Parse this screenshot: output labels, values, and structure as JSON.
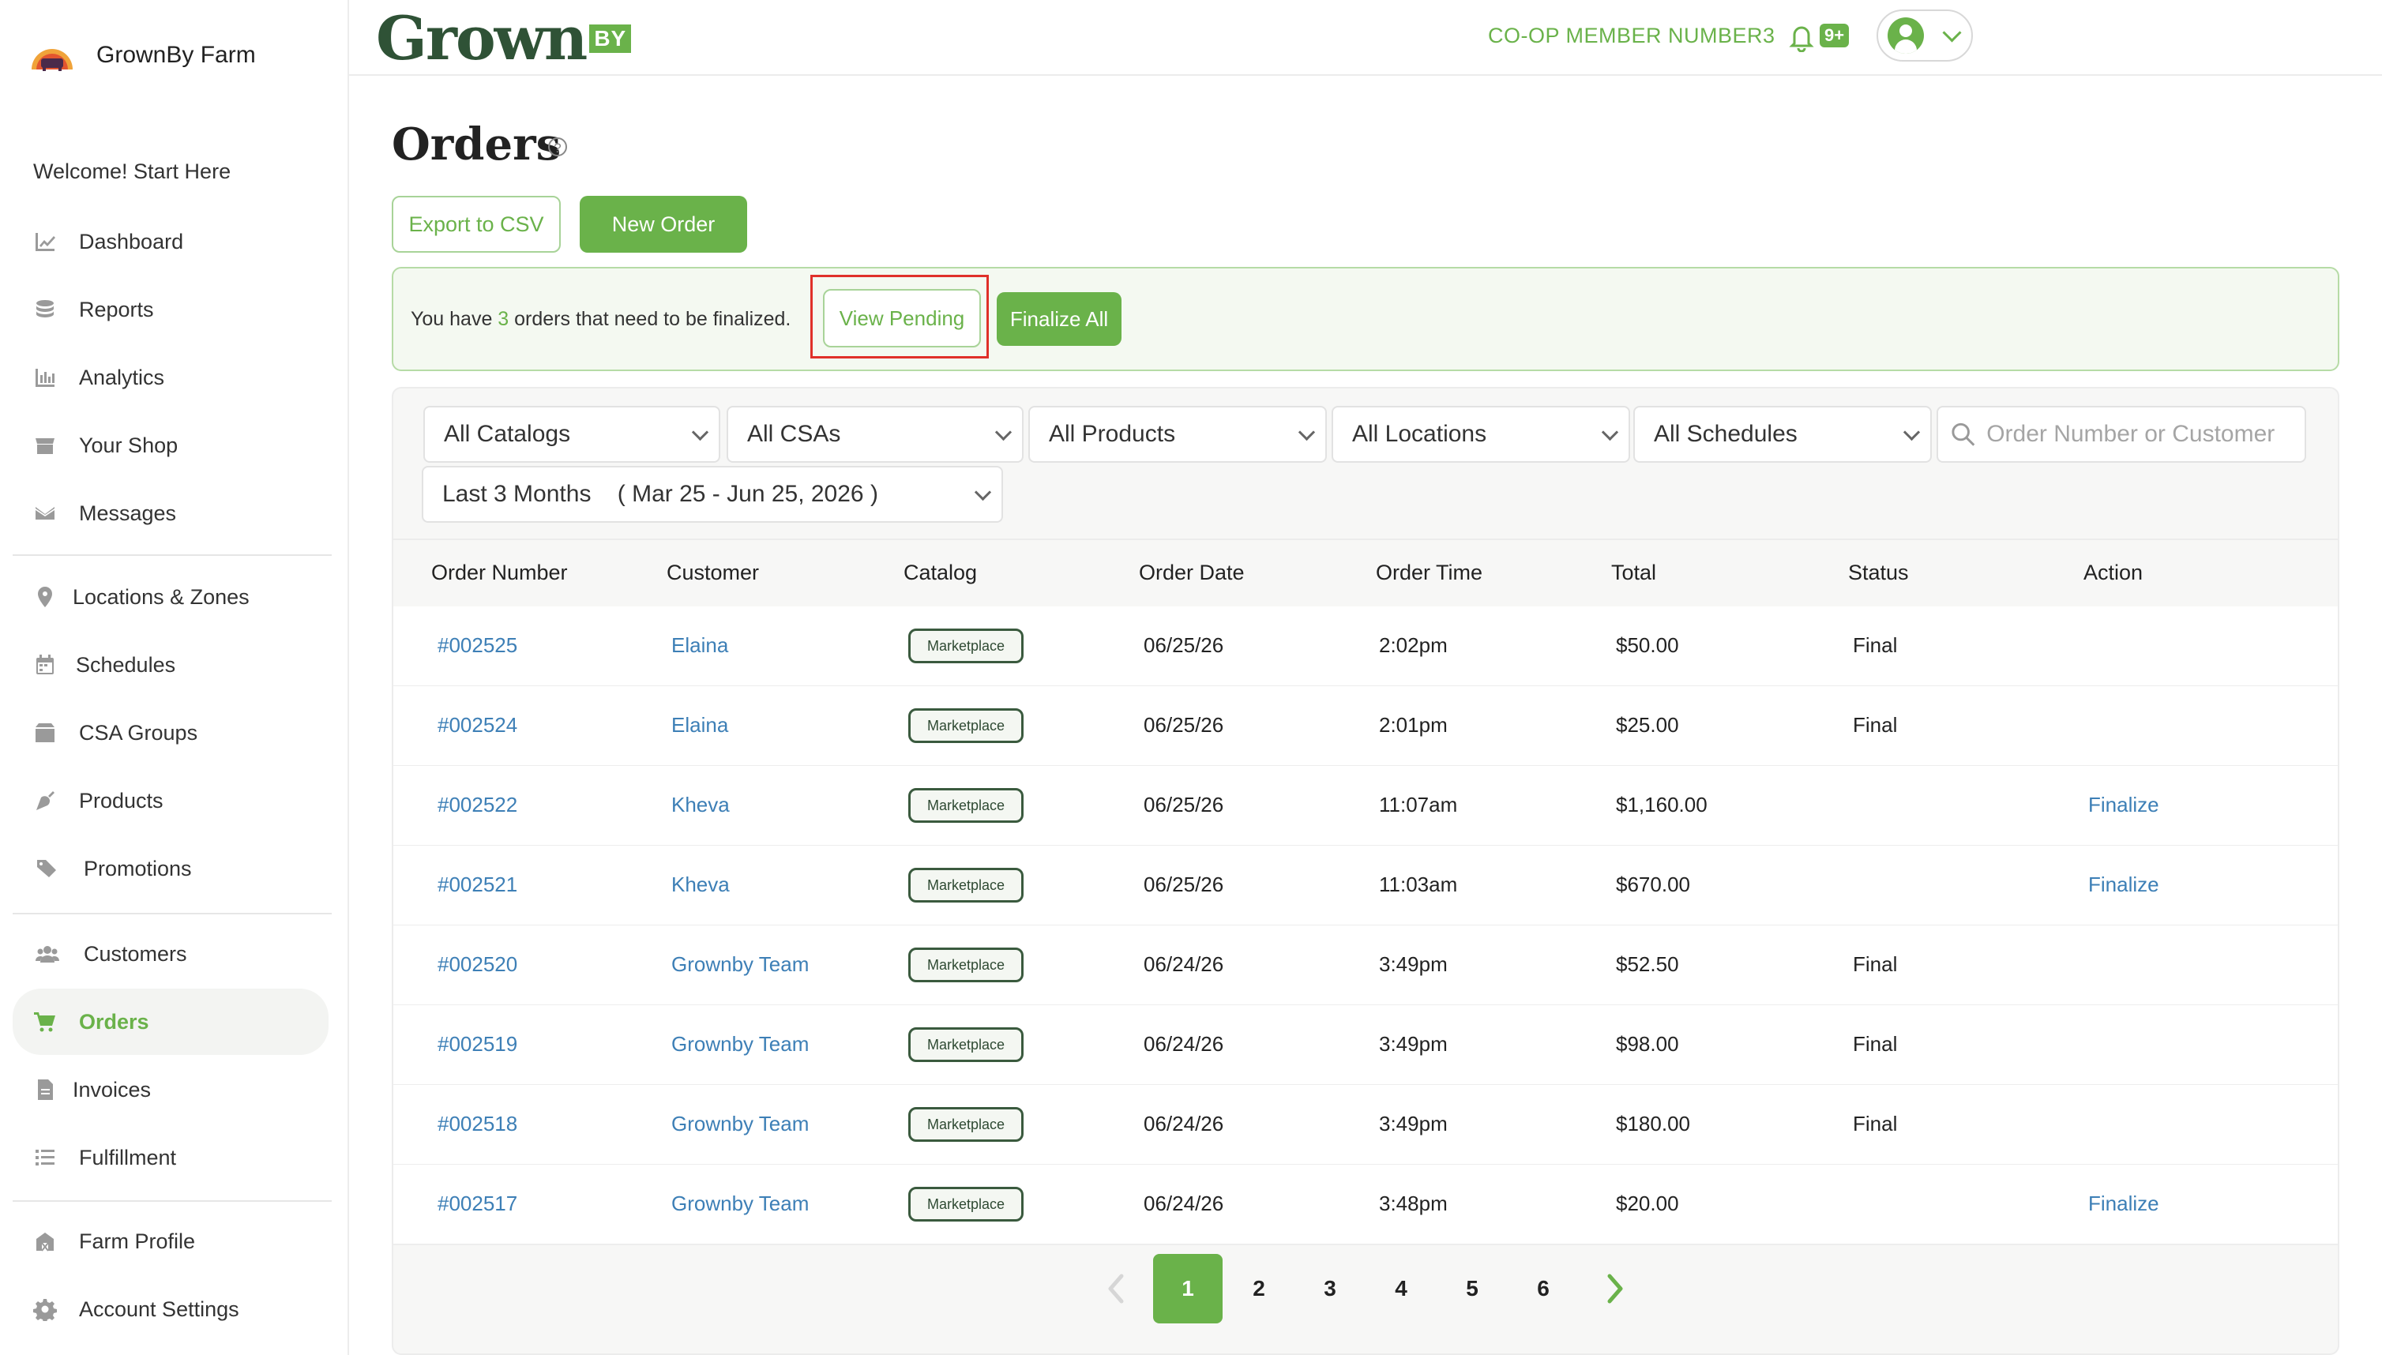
{
  "sidebar": {
    "farm_name": "GrownBy Farm",
    "welcome": "Welcome! Start Here",
    "items": [
      {
        "label": "Dashboard",
        "icon": "chart-line-icon"
      },
      {
        "label": "Reports",
        "icon": "coins-icon"
      },
      {
        "label": "Analytics",
        "icon": "bar-chart-icon"
      },
      {
        "label": "Your Shop",
        "icon": "store-icon"
      },
      {
        "label": "Messages",
        "icon": "envelope-icon"
      },
      {
        "label": "Locations & Zones",
        "icon": "map-pin-icon"
      },
      {
        "label": "Schedules",
        "icon": "calendar-icon"
      },
      {
        "label": "CSA Groups",
        "icon": "box-icon"
      },
      {
        "label": "Products",
        "icon": "carrot-icon"
      },
      {
        "label": "Promotions",
        "icon": "tags-icon"
      },
      {
        "label": "Customers",
        "icon": "users-icon"
      },
      {
        "label": "Orders",
        "icon": "cart-icon",
        "active": true
      },
      {
        "label": "Invoices",
        "icon": "invoice-icon"
      },
      {
        "label": "Fulfillment",
        "icon": "list-icon"
      },
      {
        "label": "Farm Profile",
        "icon": "farm-icon"
      },
      {
        "label": "Account Settings",
        "icon": "gear-icon"
      }
    ]
  },
  "header": {
    "brand_word": "Grown",
    "brand_badge": "BY",
    "member_label": "CO-OP MEMBER NUMBER3",
    "notification_count": "9+"
  },
  "page": {
    "title": "Orders",
    "export_label": "Export to CSV",
    "new_order_label": "New Order"
  },
  "alert": {
    "prefix": "You have ",
    "count": "3",
    "suffix": " orders that need to be finalized.",
    "view_pending_label": "View Pending",
    "finalize_all_label": "Finalize All"
  },
  "filters": {
    "catalogs": "All Catalogs",
    "csas": "All CSAs",
    "products": "All Products",
    "locations": "All Locations",
    "schedules": "All Schedules",
    "search_placeholder": "Order Number or Customer",
    "date_range": "Last 3 Months    ( Mar 25 - Jun 25, 2026 )"
  },
  "table": {
    "headers": [
      "Order Number",
      "Customer",
      "Catalog",
      "Order Date",
      "Order Time",
      "Total",
      "Status",
      "Action"
    ],
    "rows": [
      {
        "order": "#002525",
        "customer": "Elaina",
        "catalog": "Marketplace",
        "date": "06/25/26",
        "time": "2:02pm",
        "total": "$50.00",
        "status": "Final",
        "action": ""
      },
      {
        "order": "#002524",
        "customer": "Elaina",
        "catalog": "Marketplace",
        "date": "06/25/26",
        "time": "2:01pm",
        "total": "$25.00",
        "status": "Final",
        "action": ""
      },
      {
        "order": "#002522",
        "customer": "Kheva",
        "catalog": "Marketplace",
        "date": "06/25/26",
        "time": "11:07am",
        "total": "$1,160.00",
        "status": "",
        "action": "Finalize"
      },
      {
        "order": "#002521",
        "customer": "Kheva",
        "catalog": "Marketplace",
        "date": "06/25/26",
        "time": "11:03am",
        "total": "$670.00",
        "status": "",
        "action": "Finalize"
      },
      {
        "order": "#002520",
        "customer": "Grownby Team",
        "catalog": "Marketplace",
        "date": "06/24/26",
        "time": "3:49pm",
        "total": "$52.50",
        "status": "Final",
        "action": ""
      },
      {
        "order": "#002519",
        "customer": "Grownby Team",
        "catalog": "Marketplace",
        "date": "06/24/26",
        "time": "3:49pm",
        "total": "$98.00",
        "status": "Final",
        "action": ""
      },
      {
        "order": "#002518",
        "customer": "Grownby Team",
        "catalog": "Marketplace",
        "date": "06/24/26",
        "time": "3:49pm",
        "total": "$180.00",
        "status": "Final",
        "action": ""
      },
      {
        "order": "#002517",
        "customer": "Grownby Team",
        "catalog": "Marketplace",
        "date": "06/24/26",
        "time": "3:48pm",
        "total": "$20.00",
        "status": "",
        "action": "Finalize"
      }
    ]
  },
  "pagination": {
    "pages": [
      "1",
      "2",
      "3",
      "4",
      "5",
      "6"
    ],
    "current": "1"
  },
  "colors": {
    "accent": "#6ab24a",
    "link": "#3d7fb6",
    "brand_dark": "#2f5236",
    "highlight": "#e0302a"
  }
}
